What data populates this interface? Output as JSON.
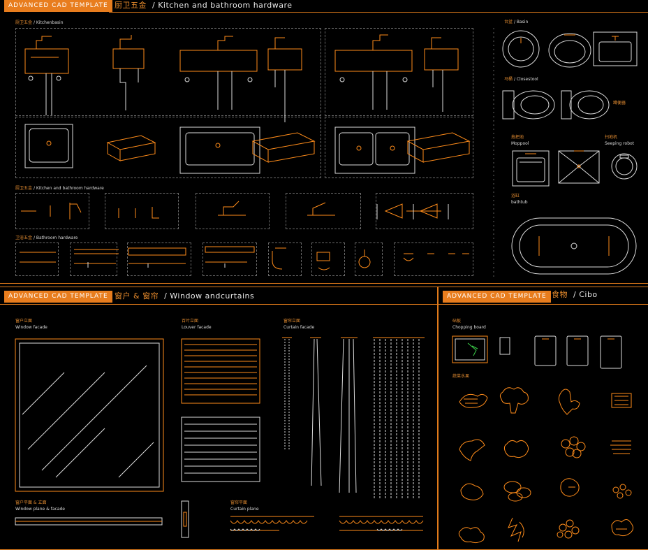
{
  "template_label": "ADVANCED  CAD  TEMPLATE",
  "panels": {
    "hardware": {
      "title_cn": "厨卫五金",
      "title_en": "/  Kitchen and bathroom hardware",
      "sections": {
        "kitchen_basin": {
          "cn": "厨卫五金",
          "en": "/ Kitchenbasin"
        },
        "basin": {
          "cn": "台盆",
          "en": "/ Basin"
        },
        "closestool": {
          "cn": "马桶",
          "en": "/ Closestool"
        },
        "squatting": {
          "cn": "蹲便器",
          "en": ""
        },
        "mop_pool": {
          "cn": "拖把池",
          "en": "Moppool"
        },
        "seeping_robot": {
          "cn": "扫地机",
          "en": "Seeping robot"
        },
        "bathtub": {
          "cn": "浴缸",
          "en": "bathtub"
        },
        "kitchen_hardware": {
          "cn": "厨卫五金",
          "en": "/ Kitchen and bathroom hardware"
        },
        "bathroom_hardware": {
          "cn": "卫浴五金",
          "en": "/ Bathroom hardware"
        }
      }
    },
    "window": {
      "title_cn": "窗户 & 窗帘",
      "title_en": "/  Window andcurtains",
      "sections": {
        "window_facade": {
          "cn": "窗户立面",
          "en": "Window facade"
        },
        "louver_facade": {
          "cn": "百叶立面",
          "en": "Louver facade"
        },
        "curtain_facade": {
          "cn": "窗帘立面",
          "en": "Curtain facade"
        },
        "window_plane": {
          "cn": "窗户平面 & 立面",
          "en": "Window plane & facade"
        },
        "curtain_plane": {
          "cn": "窗帘平面",
          "en": "Curtain plane"
        }
      }
    },
    "food": {
      "title_cn": "食物",
      "title_en": "/  Cibo",
      "sections": {
        "chopping_board": {
          "cn": "砧板",
          "en": "Chopping board"
        },
        "vegetables": {
          "cn": "蔬菜水果",
          "en": ""
        }
      }
    }
  },
  "colors": {
    "accent": "#e87d1e",
    "line": "#dcdcdc",
    "background": "#000000"
  },
  "icons": [
    "kitchen-sink-icon",
    "basin-icon",
    "closestool-icon",
    "mop-pool-icon",
    "robot-icon",
    "bathtub-icon",
    "faucet-icon",
    "towel-rail-icon",
    "window-icon",
    "louver-icon",
    "curtain-icon",
    "chopping-board-icon",
    "vegetable-icon"
  ]
}
